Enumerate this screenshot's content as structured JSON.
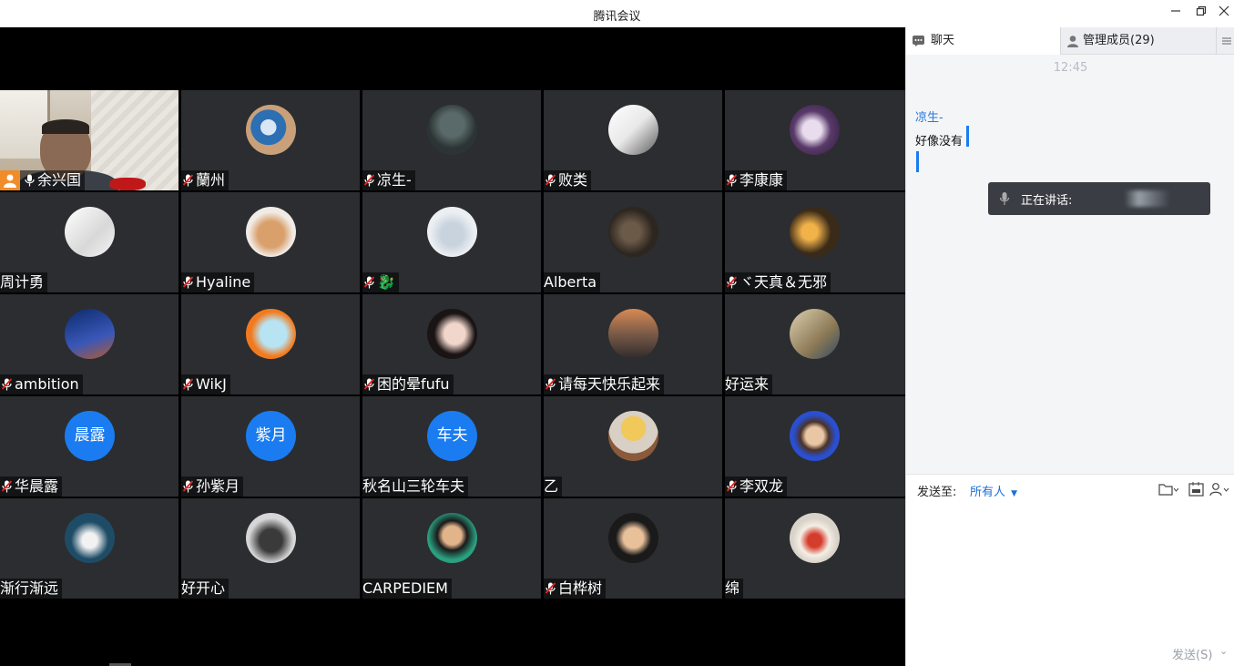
{
  "window": {
    "title": "腾讯会议",
    "min_icon": "minimize-icon",
    "max_icon": "restore-icon",
    "close_icon": "close-icon"
  },
  "participants": [
    {
      "name": "余兴国",
      "muted": false,
      "host": true,
      "video": true
    },
    {
      "name": "蘭州",
      "muted": true,
      "avatar": "photo"
    },
    {
      "name": "凉生-",
      "muted": true,
      "avatar": "photo"
    },
    {
      "name": "败类",
      "muted": true,
      "avatar": "photo"
    },
    {
      "name": "李康康",
      "muted": true,
      "avatar": "photo"
    },
    {
      "name": "周计勇",
      "muted": false,
      "avatar": "photo"
    },
    {
      "name": "Hyaline",
      "muted": true,
      "avatar": "photo"
    },
    {
      "name": "🐉",
      "muted": true,
      "avatar": "photo"
    },
    {
      "name": "Alberta",
      "muted": false,
      "avatar": "photo"
    },
    {
      "name": "ヾ天真＆无邪",
      "muted": true,
      "avatar": "photo"
    },
    {
      "name": "ambition",
      "muted": true,
      "avatar": "photo"
    },
    {
      "name": "WikJ",
      "muted": true,
      "avatar": "photo"
    },
    {
      "name": "困的晕fufu",
      "muted": true,
      "avatar": "photo"
    },
    {
      "name": "请每天快乐起来",
      "muted": true,
      "avatar": "photo"
    },
    {
      "name": "好运来",
      "muted": false,
      "avatar": "photo"
    },
    {
      "name": "华晨露",
      "muted": true,
      "avatar_text": "晨露"
    },
    {
      "name": "孙紫月",
      "muted": true,
      "avatar_text": "紫月"
    },
    {
      "name": "秋名山三轮车夫",
      "muted": false,
      "avatar_text": "车夫"
    },
    {
      "name": "乙",
      "muted": false,
      "avatar": "photo"
    },
    {
      "name": "李双龙",
      "muted": true,
      "avatar": "photo"
    },
    {
      "name": "渐行渐远",
      "muted": false,
      "avatar": "photo"
    },
    {
      "name": "好开心",
      "muted": false,
      "avatar": "photo"
    },
    {
      "name": "CARPEDIEM",
      "muted": false,
      "avatar": "photo"
    },
    {
      "name": "白桦树",
      "muted": true,
      "avatar": "photo"
    },
    {
      "name": "绵",
      "muted": false,
      "avatar": "photo"
    }
  ],
  "panel": {
    "tab_chat": "聊天",
    "tab_members": "管理成员(29)",
    "chat_time": "12:45",
    "messages": [
      {
        "sender": "凉生-",
        "text": "好像没有"
      }
    ],
    "speaking_label": "正在讲话:",
    "send_to_label": "发送至:",
    "send_to_value": "所有人",
    "send_button": "发送(S)"
  },
  "colors": {
    "accent": "#1a7cf0",
    "tile_bg": "#2b2d30",
    "mute_red": "#e02424"
  }
}
